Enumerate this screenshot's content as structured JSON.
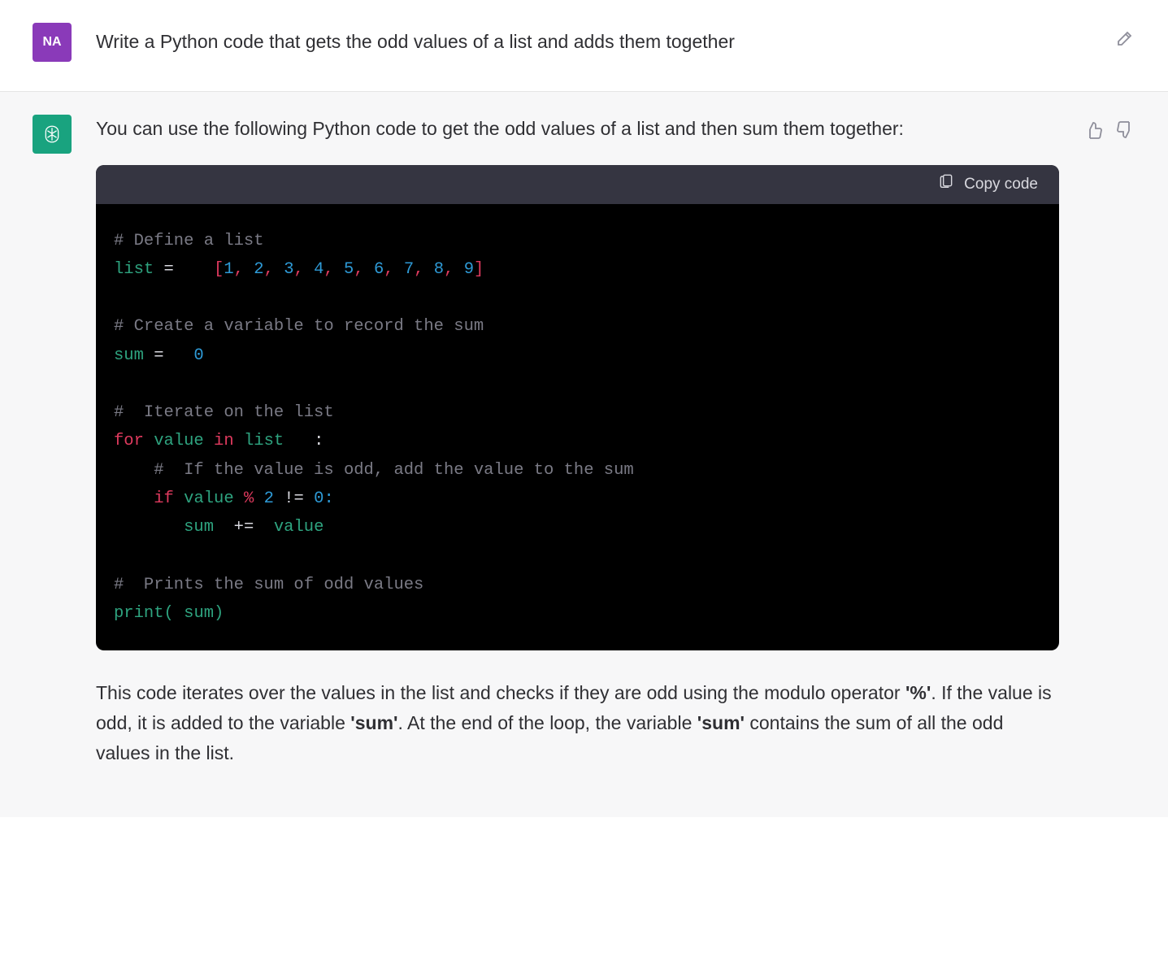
{
  "user": {
    "avatar_initials": "NA",
    "message": "Write a Python code that gets the odd values of a list and adds them together"
  },
  "assistant": {
    "intro": "You can use the following Python code to get the odd values of a list and then sum them together:",
    "code_copy_label": "Copy code",
    "code": {
      "c1": "# Define a list",
      "l2_a": "list",
      "l2_b": " =    ",
      "l2_br1": "[",
      "l2_n1": "1",
      "l2_c1": ", ",
      "l2_n2": "2",
      "l2_c2": ", ",
      "l2_n3": "3",
      "l2_c3": ", ",
      "l2_n4": "4",
      "l2_c4": ", ",
      "l2_n5": "5",
      "l2_c5": ", ",
      "l2_n6": "6",
      "l2_c6": ", ",
      "l2_n7": "7",
      "l2_c7": ", ",
      "l2_n8": "8",
      "l2_c8": ", ",
      "l2_n9": "9",
      "l2_br2": "]",
      "c2": "# Create a variable to record the sum",
      "l4_a": "sum",
      "l4_b": " =   ",
      "l4_c": "0",
      "c3": "#  Iterate on the list",
      "l6_for": "for",
      "l6_sp1": " ",
      "l6_val": "value",
      "l6_sp2": " ",
      "l6_in": "in",
      "l6_sp3": " ",
      "l6_list": "list",
      "l6_colon": "   :",
      "c4": "    #  If the value is odd, add the value to the sum",
      "l8_ind": "    ",
      "l8_if": "if",
      "l8_sp1": " ",
      "l8_val": "value",
      "l8_sp2": " ",
      "l8_mod": "%",
      "l8_sp3": " ",
      "l8_two": "2",
      "l8_sp4": " ",
      "l8_neq": "!=",
      "l8_sp5": " ",
      "l8_zero": "0",
      "l8_colon": ":",
      "l9_ind": "       ",
      "l9_sum": "sum",
      "l9_sp1": "  ",
      "l9_op": "+=",
      "l9_sp2": "  ",
      "l9_val": "value",
      "c5": "#  Prints the sum of odd values",
      "l11_print": "print",
      "l11_lp": "(",
      "l11_sp": " ",
      "l11_sum": "sum",
      "l11_rp": ")"
    },
    "explain_1": "This code iterates over the values in the list and checks if they are odd using the modulo operator ",
    "explain_pct": "'%'",
    "explain_2": ". If the value is odd, it is added to the variable ",
    "explain_sum1": "'sum'",
    "explain_3": ". At the end of the loop, the variable ",
    "explain_sum2": "'sum'",
    "explain_4": " contains the sum of all the odd values in the list."
  }
}
